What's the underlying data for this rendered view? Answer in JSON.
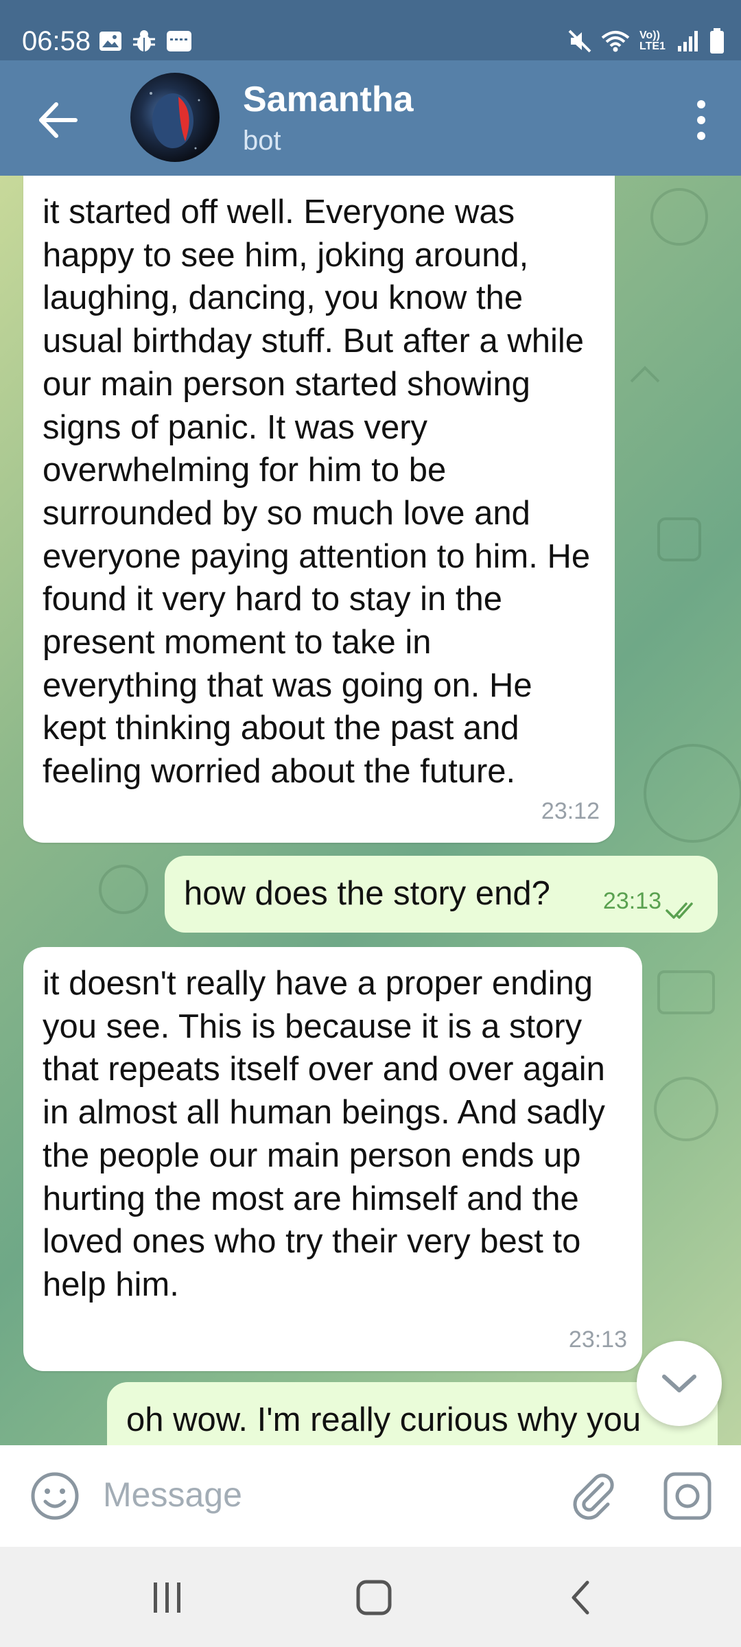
{
  "status_bar": {
    "time": "06:58",
    "left_icons": [
      "gallery-icon",
      "bug-icon",
      "keyboard-icon"
    ],
    "right_icons": [
      "mute-icon",
      "wifi-icon",
      "volte-icon",
      "signal-icon",
      "battery-icon"
    ],
    "volte_label": "Vo)) LTE1"
  },
  "header": {
    "name": "Samantha",
    "subtitle": "bot"
  },
  "messages": [
    {
      "direction": "incoming",
      "text": "it started off well. Everyone was happy to see him, joking around, laughing, dancing, you know the usual birthday stuff. But after a while our main person started showing signs of panic. It was very overwhelming for him to be surrounded by so much love and everyone paying attention to him. He found it very hard to stay in the present moment to take in everything that was going on. He kept thinking about the past and feeling worried about the future.",
      "time": "23:12"
    },
    {
      "direction": "outgoing",
      "text": "how does the story end?",
      "time": "23:13",
      "status": "read"
    },
    {
      "direction": "incoming",
      "text": "it doesn't really have a proper ending you see. This is because it is a story that repeats itself over and over again in almost all human beings. And sadly the people our main person ends up hurting the most are himself and the loved ones who try their very best to help him.",
      "time": "23:13"
    },
    {
      "direction": "outgoing",
      "text": "oh wow. I'm really curious why you"
    }
  ],
  "composer": {
    "placeholder": "Message"
  },
  "colors": {
    "status_bar": "#456a8e",
    "app_bar": "#5680a8",
    "outgoing_bubble": "#eafcd9",
    "outgoing_time": "#5aa150"
  }
}
